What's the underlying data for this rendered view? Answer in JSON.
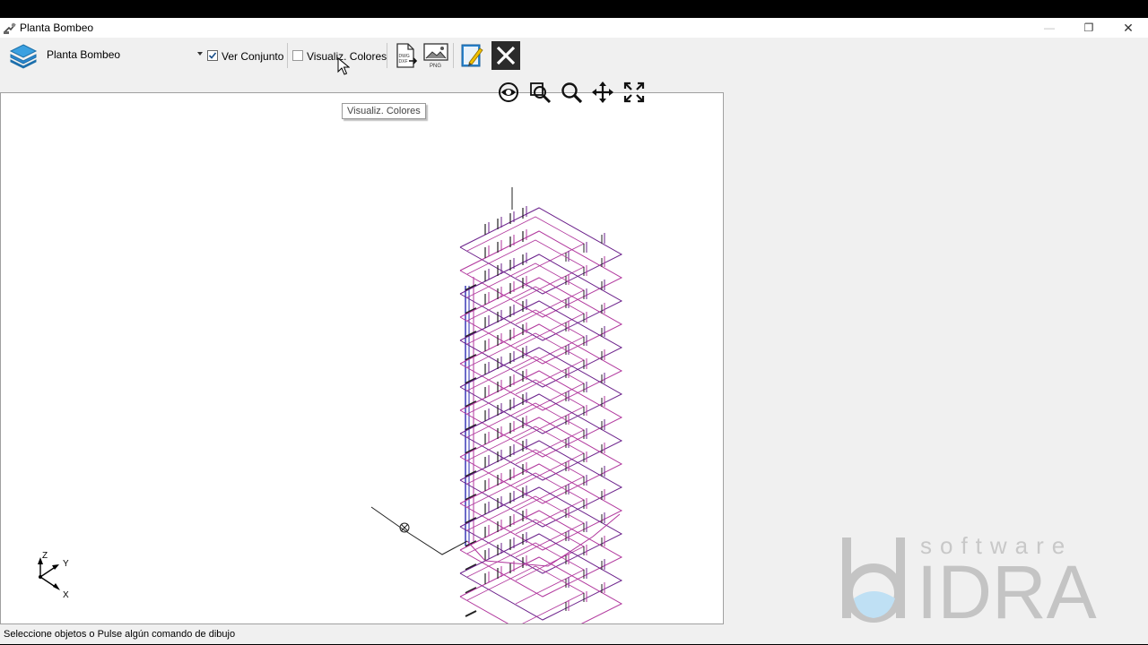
{
  "window": {
    "title": "Planta Bombeo",
    "buttons": {
      "minimize": "—",
      "restore": "❐",
      "close": "✕"
    }
  },
  "toolbar": {
    "combo_value": "Planta Bombeo",
    "ver_conjunto": {
      "label": "Ver Conjunto",
      "checked": true
    },
    "visualiz_colores": {
      "label": "Visualiz. Colores",
      "checked": false
    },
    "buttons": [
      "dwg-dxf-export",
      "png-export",
      "edit-notes",
      "close-view"
    ],
    "icon_texts": {
      "dwg": "DWG",
      "dxf": "DXF",
      "png": "PNG"
    }
  },
  "tooltip": "Visualiz. Colores",
  "view_tools": [
    "eye-icon",
    "zoom-window-icon",
    "zoom-icon",
    "pan-icon",
    "zoom-extents-icon"
  ],
  "axes": {
    "z": "Z",
    "y": "Y",
    "x": "X"
  },
  "status": "Seleccione objetos o Pulse algún comando de dibujo",
  "watermark": {
    "top": "software",
    "brand": "IDRA"
  },
  "colors": {
    "pipe_magenta": "#b0359c",
    "pipe_blue": "#2a2ab0",
    "line_dark": "#222222",
    "accent_blue": "#2b87d1"
  }
}
